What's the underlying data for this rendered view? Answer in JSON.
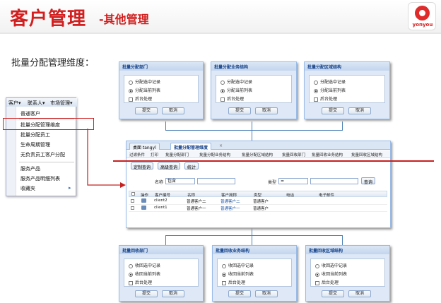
{
  "header": {
    "title_main": "客户管理",
    "title_sub": "-其他管理",
    "logo_text": "yonyou"
  },
  "intro": "批量分配管理维度：",
  "top_dialogs": [
    {
      "title": "批量分配部门",
      "opt1": "分配选中记录",
      "opt2": "分配当前列表",
      "check": "后台处理",
      "ok": "提交",
      "cancel": "取消"
    },
    {
      "title": "批量分配业务结构",
      "opt1": "分配选中记录",
      "opt2": "分配当前列表",
      "check": "后台处理",
      "ok": "提交",
      "cancel": "取消"
    },
    {
      "title": "批量分配区域结构",
      "opt1": "分配选中记录",
      "opt2": "分配当前列表",
      "check": "后台处理",
      "ok": "提交",
      "cancel": "取消"
    }
  ],
  "bottom_dialogs": [
    {
      "title": "批量回收部门",
      "opt1": "收回选中记录",
      "opt2": "收回当前列表",
      "check": "后台处理",
      "ok": "提交",
      "cancel": "取消"
    },
    {
      "title": "批量回收业务结构",
      "opt1": "收回选中记录",
      "opt2": "收回当前列表",
      "check": "后台处理",
      "ok": "提交",
      "cancel": "取消"
    },
    {
      "title": "批量回收区域结构",
      "opt1": "收回选中记录",
      "opt2": "收回当前列表",
      "check": "后台处理",
      "ok": "提交",
      "cancel": "取消"
    }
  ],
  "menu": {
    "bar": [
      "客户▾",
      "联系人▾",
      "市场管理▾"
    ],
    "items": [
      "普通客户",
      "批量分配管理维度",
      "批量分配员工",
      "生命周期管理",
      "无负责员工客户分配",
      "服务产品",
      "服务产品明细列表",
      "收藏夹"
    ],
    "submenu_arrow": "▸"
  },
  "main": {
    "tabs": [
      "桌面 tangyl",
      "批量分配管理维度"
    ],
    "tab_close": "×",
    "toolbar": [
      "过滤条件",
      "打印",
      "批量分配部门",
      "批量分配业务结构",
      "批量分配区域结构",
      "批量回收部门",
      "批量回收业务结构",
      "批量回收区域结构"
    ],
    "query_buttons": [
      "定制查询",
      "高级查询",
      "统计"
    ],
    "filter_name_label": "名称",
    "filter_name_op": "包含",
    "filter_type_label": "类型",
    "filter_type_op": "=",
    "filter_type_val": "",
    "search": "查询",
    "columns": [
      "操作",
      "客户编号",
      "名称",
      "客户简称",
      "类型",
      "电话",
      "电子邮件"
    ],
    "rows": [
      {
        "code": "client2",
        "name": "普通客户二",
        "short": "普通客户二",
        "type": "普通客户"
      },
      {
        "code": "client1",
        "name": "普通客户一",
        "short": "普通客户一",
        "type": "普通客户"
      }
    ]
  },
  "colors": {
    "brand_red": "#d21f1f",
    "link_blue": "#1d55a5",
    "panel_border": "#99bbe8"
  }
}
